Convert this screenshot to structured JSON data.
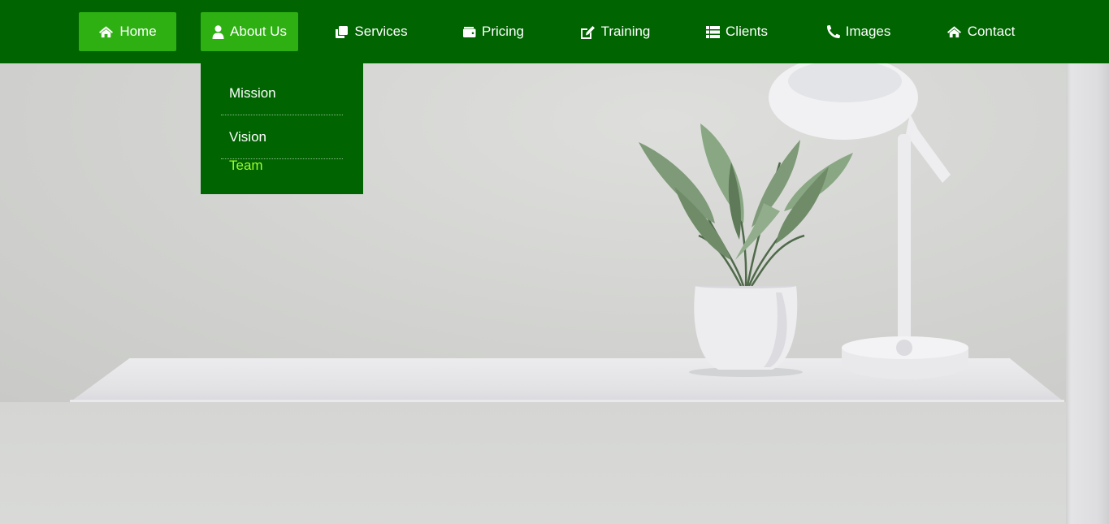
{
  "nav": {
    "items": [
      {
        "label": "Home",
        "icon": "home-icon"
      },
      {
        "label": "About Us",
        "icon": "user-icon"
      },
      {
        "label": "Services",
        "icon": "copy-icon"
      },
      {
        "label": "Pricing",
        "icon": "wallet-icon"
      },
      {
        "label": "Training",
        "icon": "edit-icon"
      },
      {
        "label": "Clients",
        "icon": "list-icon"
      },
      {
        "label": "Images",
        "icon": "phone-icon"
      },
      {
        "label": "Contact",
        "icon": "home-icon"
      }
    ]
  },
  "dropdown": {
    "parent": "About Us",
    "items": [
      {
        "label": "Mission"
      },
      {
        "label": "Vision"
      },
      {
        "label": "Team"
      }
    ]
  },
  "colors": {
    "nav_bg": "#006400",
    "active_bg": "#2eb012",
    "highlight_text": "#9cff2e",
    "text": "#ffffff"
  }
}
